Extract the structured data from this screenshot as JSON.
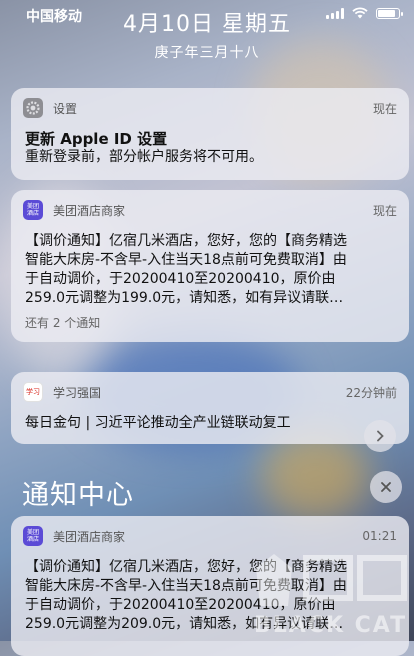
{
  "status": {
    "carrier": "中国移动"
  },
  "lock": {
    "date": "4月10日 星期五",
    "lunar": "庚子年三月十八"
  },
  "notifications": [
    {
      "app": "设置",
      "time": "现在",
      "title": "更新 Apple ID 设置",
      "body": "重新登录前，部分帐户服务将不可用。"
    },
    {
      "app": "美团酒店商家",
      "icon_text": "美团酒店",
      "time": "现在",
      "body_lines": [
        "【调价通知】亿宿几米酒店，您好，您的【商务精选",
        "智能大床房-不含早-入住当天18点前可免费取消】由",
        "于自动调价，于20200410至20200410，原价由",
        "259.0元调整为199.0元，请知悉，如有异议请联…"
      ],
      "more": "还有 2 个通知"
    },
    {
      "app": "学习强国",
      "icon_text": "学习",
      "time": "22分钟前",
      "body": "每日金句 | 习近平论推动全产业链联动复工"
    }
  ],
  "center": {
    "title": "通知中心"
  },
  "history": [
    {
      "app": "美团酒店商家",
      "icon_text": "美团酒店",
      "time": "01:21",
      "body_lines": [
        "【调价通知】亿宿几米酒店，您好，您的【商务精选",
        "智能大床房-不含早-入住当天18点前可免费取消】由",
        "于自动调价，于20200410至20200410，原价由",
        "259.0元调整为209.0元，请知悉，如有异议请联…"
      ]
    }
  ],
  "watermark": {
    "text": "BLACK CAT"
  },
  "colors": {
    "meituan": "#5b4bd6",
    "xuexi": "#d82a20",
    "settings": "#8e8e93"
  }
}
